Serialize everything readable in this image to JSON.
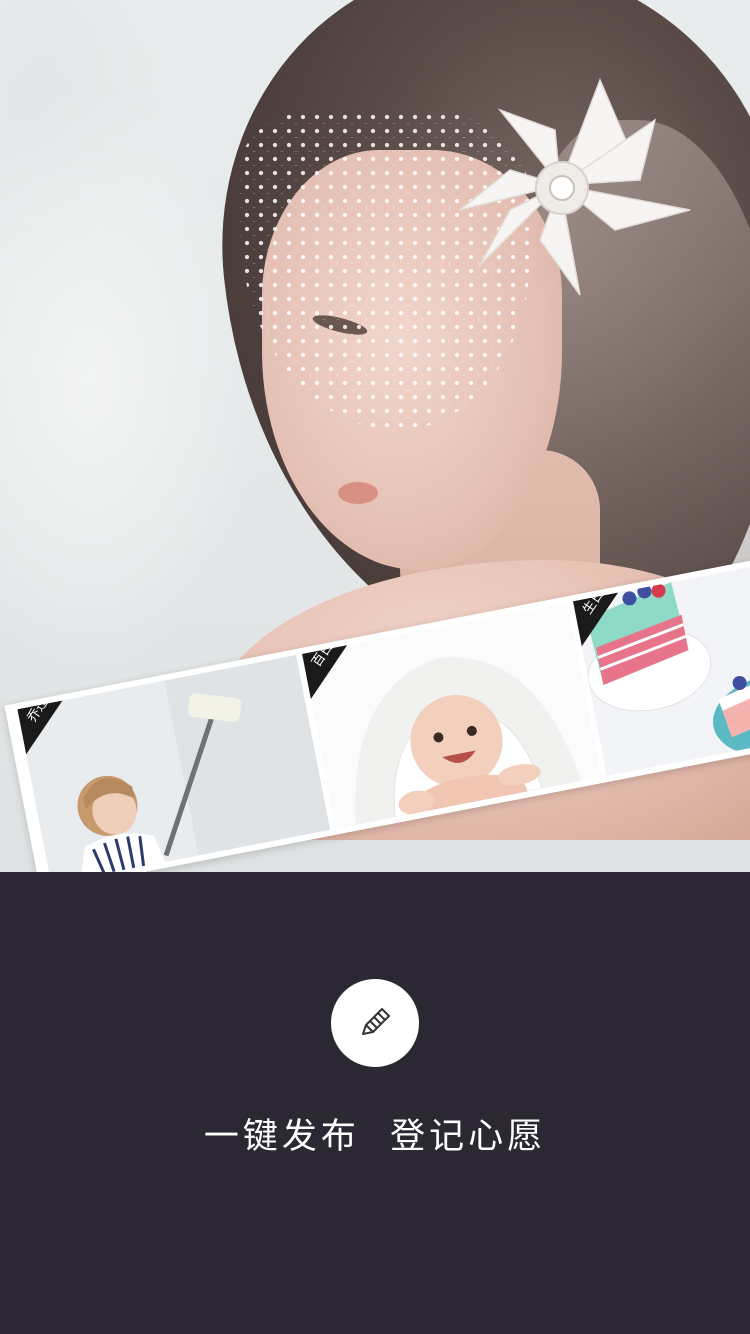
{
  "hero": {
    "description_icon": "bride-photo"
  },
  "strip": {
    "tiles": [
      {
        "tag": "乔迁",
        "icon": "painting-photo"
      },
      {
        "tag": "百日",
        "icon": "baby-photo"
      },
      {
        "tag": "生日",
        "icon": "cake-photo"
      }
    ]
  },
  "panel": {
    "edit_icon": "pencil-icon",
    "slogan": "一键发布  登记心愿"
  },
  "colors": {
    "panel_bg": "#2b2833",
    "button_bg": "#ffffff",
    "text": "#ffffff",
    "tag_bg": "#1a1a1a"
  }
}
